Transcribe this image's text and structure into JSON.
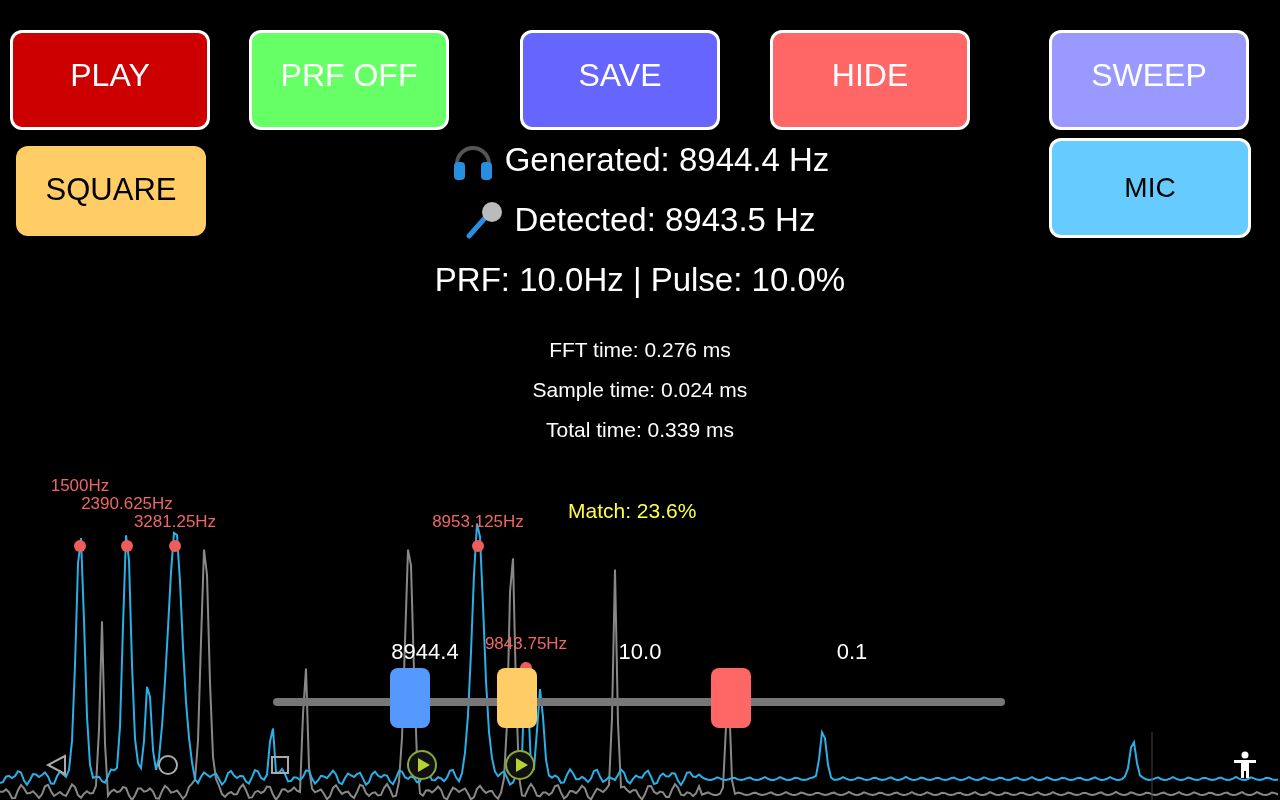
{
  "top_buttons": [
    {
      "label": "PLAY",
      "color": "#cc0000"
    },
    {
      "label": "PRF OFF",
      "color": "#66ff66"
    },
    {
      "label": "SAVE",
      "color": "#6666ff"
    },
    {
      "label": "HIDE",
      "color": "#ff6666"
    },
    {
      "label": "SWEEP",
      "color": "#9999ff"
    }
  ],
  "wave_button": {
    "label": "SQUARE",
    "color": "#ffcc66"
  },
  "mic_button": {
    "label": "MIC",
    "color": "#66ccff"
  },
  "readouts": {
    "generated": "Generated: 8944.4 Hz",
    "detected": "Detected: 8943.5 Hz",
    "prf": "PRF: 10.0Hz | Pulse: 10.0%"
  },
  "timings": [
    "FFT time: 0.276 ms",
    "Sample time: 0.024 ms",
    "Total time: 0.339 ms"
  ],
  "match": "Match: 23.6%",
  "peak_labels": [
    {
      "text": "1500Hz"
    },
    {
      "text": "2390.625Hz"
    },
    {
      "text": "3281.25Hz"
    },
    {
      "text": "8953.125Hz"
    },
    {
      "text": "9843.75Hz"
    }
  ],
  "sliders": [
    {
      "value": "8944.4",
      "level": 0.187,
      "color": "#5599ff"
    },
    {
      "value": "10.0",
      "level": 0.333,
      "color": "#ffcc66"
    },
    {
      "value": "0.1",
      "level": 0.625,
      "color": "#ff6666"
    }
  ]
}
